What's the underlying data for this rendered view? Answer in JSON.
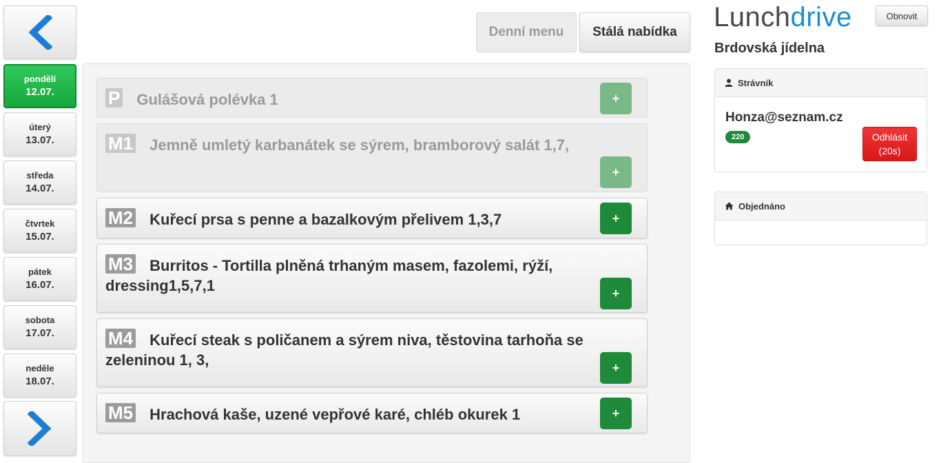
{
  "days": [
    {
      "name": "pondělí",
      "date": "12.07.",
      "active": true
    },
    {
      "name": "úterý",
      "date": "13.07."
    },
    {
      "name": "středa",
      "date": "14.07."
    },
    {
      "name": "čtvrtek",
      "date": "15.07."
    },
    {
      "name": "pátek",
      "date": "16.07."
    },
    {
      "name": "sobota",
      "date": "17.07."
    },
    {
      "name": "neděle",
      "date": "18.07."
    }
  ],
  "nav": {
    "prev_icon": "chevron-left-icon",
    "next_icon": "chevron-right-icon"
  },
  "tabs": [
    {
      "label": "Denní menu",
      "active": false
    },
    {
      "label": "Stálá nabídka",
      "active": true
    }
  ],
  "menu": [
    {
      "code": "P",
      "name": "Gulášová polévka 1",
      "available": false,
      "add_label": "+"
    },
    {
      "code": "M1",
      "name": "Jemně umletý karbanátek se sýrem, bramborový salát 1,7,",
      "available": false,
      "add_label": "+"
    },
    {
      "code": "M2",
      "name": "Kuřecí prsa s penne a bazalkovým přelivem 1,3,7",
      "available": true,
      "add_label": "+"
    },
    {
      "code": "M3",
      "name": "Burritos - Tortilla plněná trhaným masem, fazolemi, rýží, dressing1,5,7,1",
      "available": true,
      "add_label": "+"
    },
    {
      "code": "M4",
      "name": "Kuřecí steak s poličanem a sýrem niva, těstovina tarhoňa se zeleninou 1, 3,",
      "available": true,
      "add_label": "+"
    },
    {
      "code": "M5",
      "name": "Hrachová kaše, uzené vepřové karé, chléb okurek 1",
      "available": true,
      "add_label": "+"
    }
  ],
  "header": {
    "logo_part1": "Lunch",
    "logo_part2": "drive",
    "refresh_label": "Obnovit",
    "canteen": "Brdovská jídelna"
  },
  "diner": {
    "title": "Strávník",
    "email": "Honza@seznam.cz",
    "badge": "220",
    "logout_label": "Odhlásit",
    "logout_timer": "(20s)"
  },
  "ordered": {
    "title": "Objednáno"
  },
  "colors": {
    "active_day": "#1fb14a",
    "add_enabled": "#1e8a3a",
    "add_disabled": "#7ab887",
    "logout": "#e02222",
    "logo_accent": "#1a8fd6"
  }
}
